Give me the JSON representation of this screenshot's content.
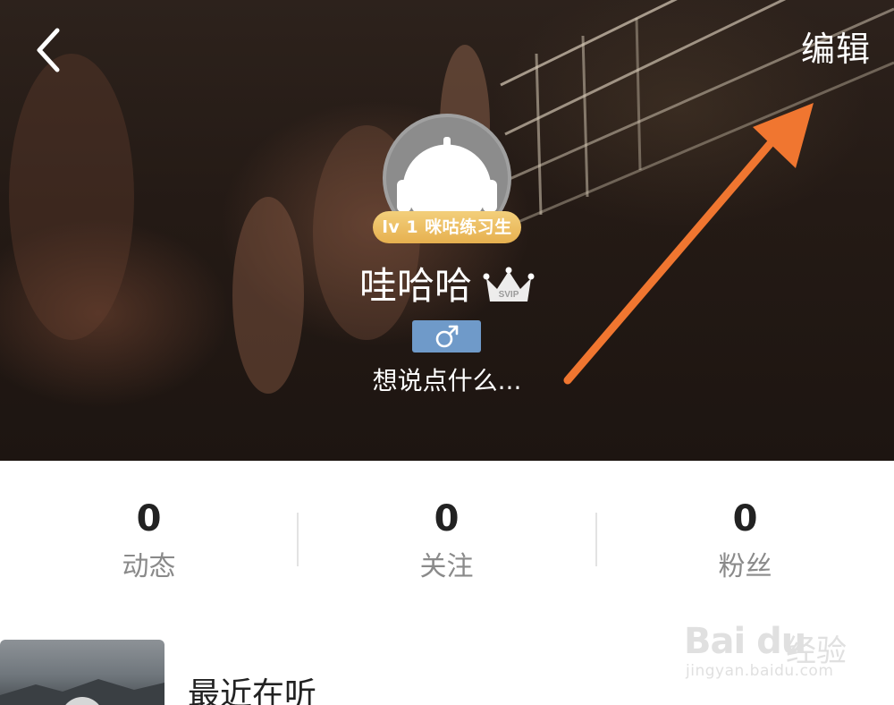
{
  "header": {
    "edit_label": "编辑",
    "icons": {
      "back": "chevron-left-icon",
      "avatar": "headphones-avatar-icon",
      "vip": "svip-crown-icon",
      "gender": "male-icon"
    }
  },
  "profile": {
    "level_badge": "lv 1 咪咕练习生",
    "username": "哇哈哈",
    "vip_badge_text": "SVIP",
    "signature": "想说点什么..."
  },
  "stats": [
    {
      "count": "0",
      "label": "动态"
    },
    {
      "count": "0",
      "label": "关注"
    },
    {
      "count": "0",
      "label": "粉丝"
    }
  ],
  "recent": {
    "title": "最近在听"
  },
  "watermark": {
    "logo": "Bai du",
    "brand_cn": "经验",
    "url": "jingyan.baidu.com"
  },
  "colors": {
    "annotation_arrow": "#f07630",
    "level_badge": "#ebb957",
    "gender_tag": "#6f9ac9",
    "stat_label": "#8a8a8a"
  }
}
